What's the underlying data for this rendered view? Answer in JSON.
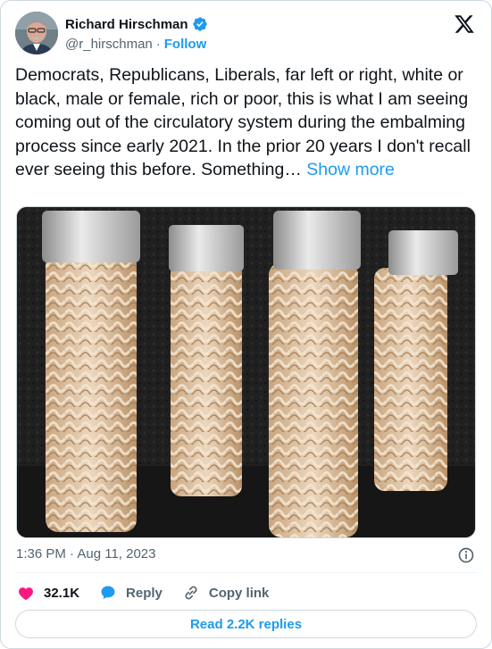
{
  "author": {
    "display_name": "Richard Hirschman",
    "handle": "@r_hirschman",
    "follow_label": "Follow",
    "separator": "·"
  },
  "tweet": {
    "text": "Democrats, Republicans, Liberals, far left or right, white or black, male or female, rich or poor, this is what I am seeing coming out of the circulatory system during the embalming process since early 2021. In the prior 20 years I don't recall ever seeing this before. Something… ",
    "show_more_label": "Show more",
    "timestamp": "1:36 PM · Aug 11, 2023"
  },
  "actions": {
    "likes_count": "32.1K",
    "reply_label": "Reply",
    "copy_link_label": "Copy link"
  },
  "read_replies_label": "Read 2.2K replies",
  "icons": {
    "verified": "verified-badge-icon",
    "logo": "x-logo-icon",
    "info": "info-icon",
    "heart": "heart-icon",
    "reply": "reply-bubble-icon",
    "link": "link-icon"
  },
  "colors": {
    "accent": "#1d9bf0",
    "like": "#f91880",
    "text": "#0f1419",
    "secondary": "#536471"
  }
}
